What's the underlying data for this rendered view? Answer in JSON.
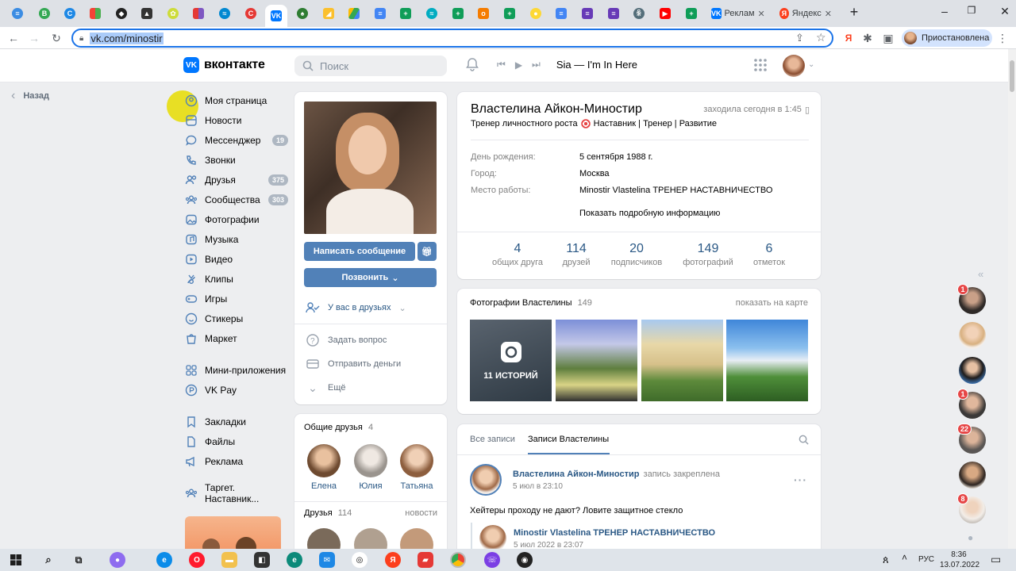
{
  "browser": {
    "tabs_wide": [
      {
        "label": "Реклам"
      },
      {
        "label": "Яндекс"
      }
    ],
    "url_text": "vk.com/minostir",
    "profile_label": "Приостановлена"
  },
  "vk": {
    "logo_text": "вконтакте",
    "logo_mark": "VK",
    "search_placeholder": "Поиск",
    "player_track": "Sia — I'm In Here",
    "back_label": "Назад",
    "nav": [
      {
        "label": "Моя страница",
        "icon": "user-icon"
      },
      {
        "label": "Новости",
        "icon": "news-icon"
      },
      {
        "label": "Мессенджер",
        "icon": "message-icon",
        "badge": "19"
      },
      {
        "label": "Звонки",
        "icon": "phone-icon"
      },
      {
        "label": "Друзья",
        "icon": "friends-icon",
        "badge": "375"
      },
      {
        "label": "Сообщества",
        "icon": "groups-icon",
        "badge": "303"
      },
      {
        "label": "Фотографии",
        "icon": "photo-icon"
      },
      {
        "label": "Музыка",
        "icon": "music-icon"
      },
      {
        "label": "Видео",
        "icon": "video-icon"
      },
      {
        "label": "Клипы",
        "icon": "clips-icon"
      },
      {
        "label": "Игры",
        "icon": "games-icon"
      },
      {
        "label": "Стикеры",
        "icon": "sticker-icon"
      },
      {
        "label": "Маркет",
        "icon": "market-icon"
      }
    ],
    "nav2": [
      {
        "label": "Мини-приложения",
        "icon": "apps-icon"
      },
      {
        "label": "VK Pay",
        "icon": "pay-icon"
      }
    ],
    "nav3": [
      {
        "label": "Закладки",
        "icon": "bookmark-icon"
      },
      {
        "label": "Файлы",
        "icon": "file-icon"
      },
      {
        "label": "Реклама",
        "icon": "ads-icon"
      }
    ],
    "nav4": [
      {
        "label": "Таргет. Наставник...",
        "icon": "community-icon"
      }
    ]
  },
  "profile": {
    "name": "Властелина Айкон-Миностир",
    "last_seen": "заходила сегодня в 1:45",
    "status_a": "Тренер личностного роста",
    "status_b": "Наставник | Тренер | Развитие",
    "write_btn": "Написать сообщение",
    "call_btn": "Позвонить",
    "friends_state": "У вас в друзьях",
    "actions": [
      "Задать вопрос",
      "Отправить деньги",
      "Ещё"
    ],
    "info": [
      {
        "label": "День рождения:",
        "value": "5 сентября 1988 г."
      },
      {
        "label": "Город:",
        "value": "Москва"
      },
      {
        "label": "Место работы:",
        "value": "Minostir Vlastelina ТРЕНЕР НАСТАВНИЧЕСТВО"
      }
    ],
    "more_info": "Показать подробную информацию",
    "counters": [
      {
        "n": "4",
        "l": "общих друга"
      },
      {
        "n": "114",
        "l": "друзей"
      },
      {
        "n": "20",
        "l": "подписчиков"
      },
      {
        "n": "149",
        "l": "фотографий"
      },
      {
        "n": "6",
        "l": "отметок"
      }
    ]
  },
  "mutual": {
    "title": "Общие друзья",
    "count": "4",
    "people": [
      "Елена",
      "Юлия",
      "Татьяна"
    ]
  },
  "friends": {
    "title": "Друзья",
    "count": "114",
    "link": "новости"
  },
  "photos": {
    "title": "Фотографии Властелины",
    "count": "149",
    "map_link": "показать на карте",
    "stories": "11 ИСТОРИЙ"
  },
  "wall": {
    "tab_all": "Все записи",
    "tab_owner": "Записи Властелины",
    "author": "Властелина Айкон-Миностир",
    "pinned": "запись закреплена",
    "date": "5 июл в 23:10",
    "text": "Хейтеры проходу не дают? Ловите защитное стекло",
    "repost_author": "Minostir Vlastelina ТРЕНЕР НАСТАВНИЧЕСТВО",
    "repost_date": "5 июл 2022 в 23:07"
  },
  "right_rail": {
    "badges": [
      "1",
      "1",
      "22",
      "8"
    ]
  },
  "taskbar": {
    "lang": "РУС",
    "time": "8:36",
    "date": "13.07.2022"
  }
}
